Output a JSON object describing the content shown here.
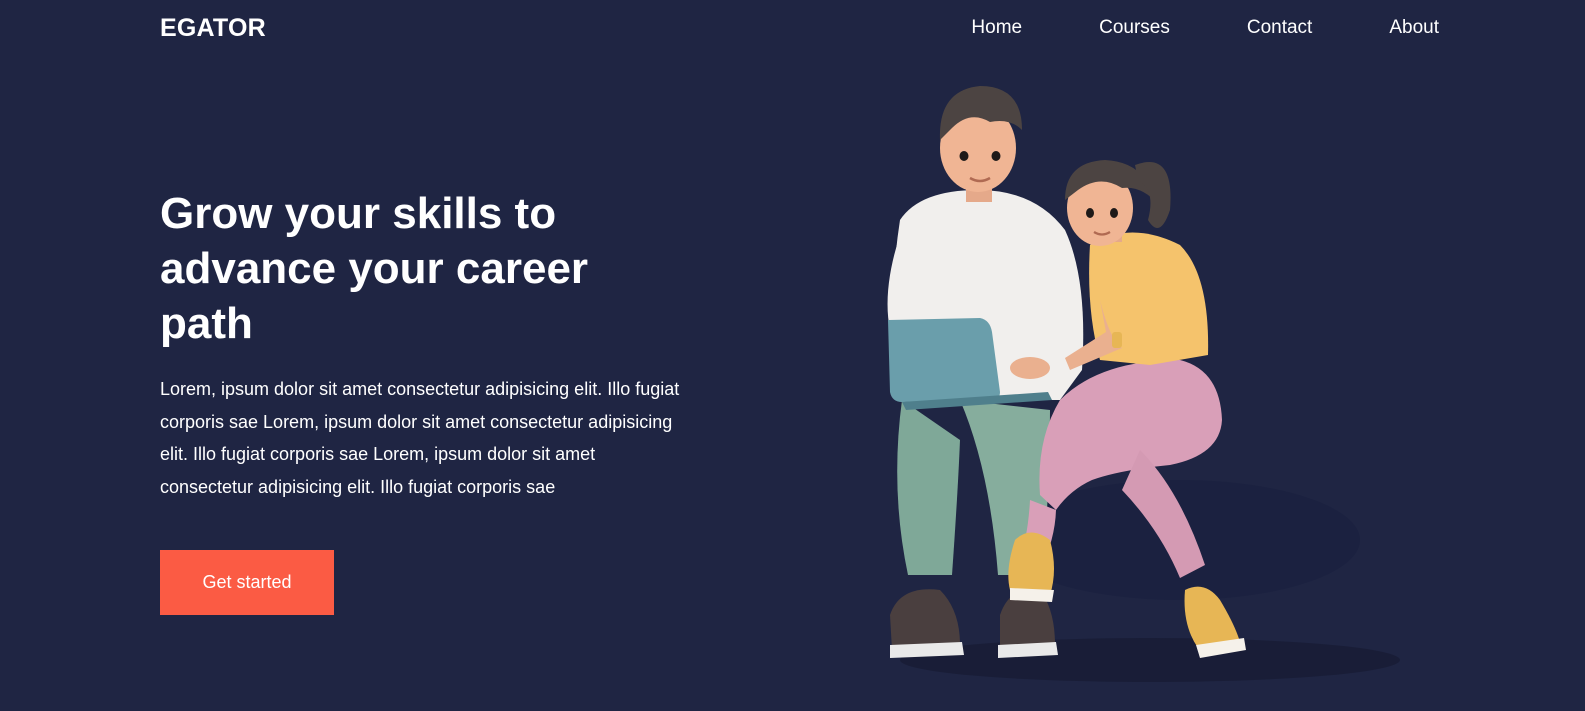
{
  "brand": {
    "logo": "EGATOR"
  },
  "nav": {
    "items": [
      {
        "label": "Home"
      },
      {
        "label": "Courses"
      },
      {
        "label": "Contact"
      },
      {
        "label": "About"
      }
    ]
  },
  "hero": {
    "title": "Grow your skills to advance your career path",
    "description": "Lorem, ipsum dolor sit amet consectetur adipisicing elit. Illo fugiat corporis sae Lorem, ipsum dolor sit amet consectetur adipisicing elit. Illo fugiat corporis sae Lorem, ipsum dolor sit amet consectetur adipisicing elit. Illo fugiat corporis sae",
    "cta_label": "Get started"
  },
  "illustration": {
    "icon": "students-with-laptop-illustration"
  },
  "colors": {
    "background": "#1f2543",
    "accent": "#fb5b44",
    "text": "#ffffff"
  }
}
